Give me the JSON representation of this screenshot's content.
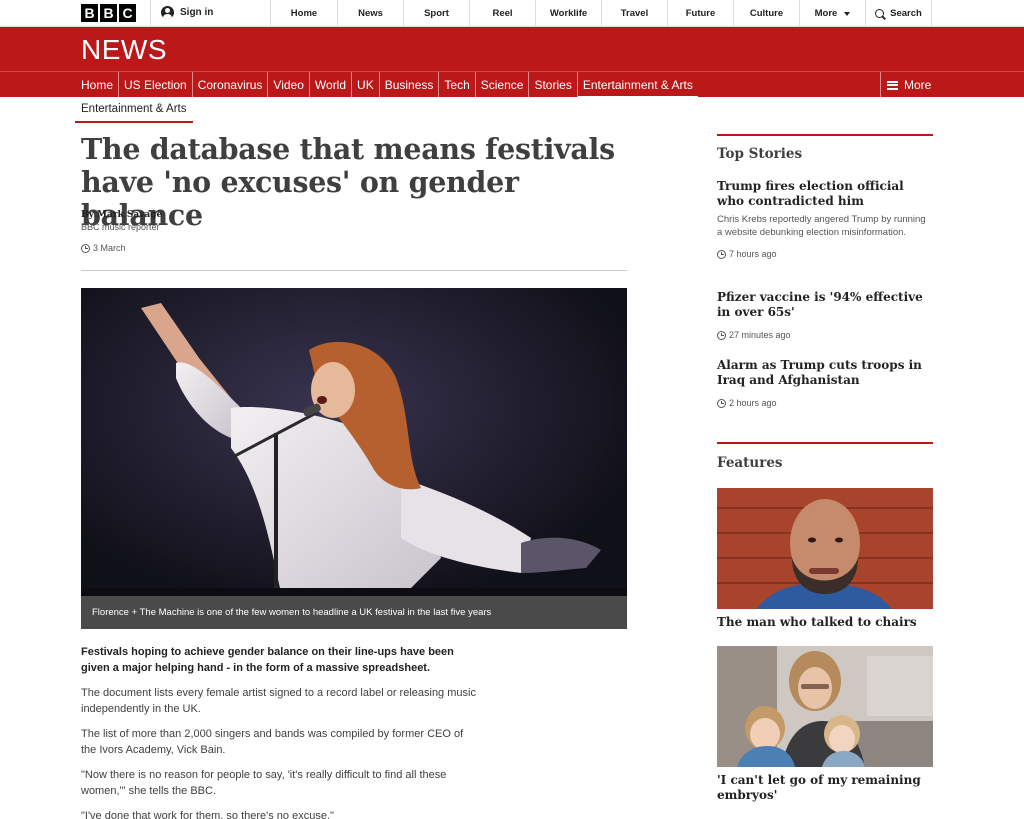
{
  "topbar": {
    "logo_letters": [
      "B",
      "B",
      "C"
    ],
    "signin_label": "Sign in",
    "nav": [
      {
        "label": "Home"
      },
      {
        "label": "News"
      },
      {
        "label": "Sport"
      },
      {
        "label": "Reel"
      },
      {
        "label": "Worklife"
      },
      {
        "label": "Travel"
      },
      {
        "label": "Future"
      },
      {
        "label": "Culture"
      },
      {
        "label": "More"
      },
      {
        "label": "Search"
      }
    ]
  },
  "brand": {
    "news_label": "NEWS",
    "red": "#bb1919"
  },
  "section_nav": {
    "items": [
      "Home",
      "US Election",
      "Coronavirus",
      "Video",
      "World",
      "UK",
      "Business",
      "Tech",
      "Science",
      "Stories",
      "Entertainment & Arts"
    ],
    "active": "Entertainment & Arts",
    "more_label": "More"
  },
  "article": {
    "section": "Entertainment & Arts",
    "headline": "The database that means festivals have 'no excuses' on gender balance",
    "author": "By Mark Savage",
    "author_role": "BBC music reporter",
    "date": "3 March",
    "image_caption": "Florence + The Machine is one of the few women to headline a UK festival in the last five years",
    "paragraphs": [
      "Festivals hoping to achieve gender balance on their line-ups have been given a major helping hand - in the form of a massive spreadsheet.",
      "The document lists every female artist signed to a record label or releasing music independently in the UK.",
      "The list of more than 2,000 singers and bands was compiled by former CEO of the Ivors Academy, Vick Bain.",
      "\"Now there is no reason for people to say, 'it's really difficult to find all these women,'\" she tells the BBC.",
      "\"I've done that work for them, so there's no excuse.\""
    ]
  },
  "top_stories": {
    "heading": "Top Stories",
    "items": [
      {
        "title": "Trump fires election official who contradicted him",
        "summary": "Chris Krebs reportedly angered Trump by running a website debunking election misinformation.",
        "time": "7 hours ago"
      },
      {
        "title": "Pfizer vaccine is '94% effective in over 65s'",
        "summary": "",
        "time": "27 minutes ago"
      },
      {
        "title": "Alarm as Trump cuts troops in Iraq and Afghanistan",
        "summary": "",
        "time": "2 hours ago"
      }
    ]
  },
  "features": {
    "heading": "Features",
    "items": [
      {
        "title": "The man who talked to chairs"
      },
      {
        "title": "'I can't let go of my remaining embryos'"
      }
    ]
  }
}
